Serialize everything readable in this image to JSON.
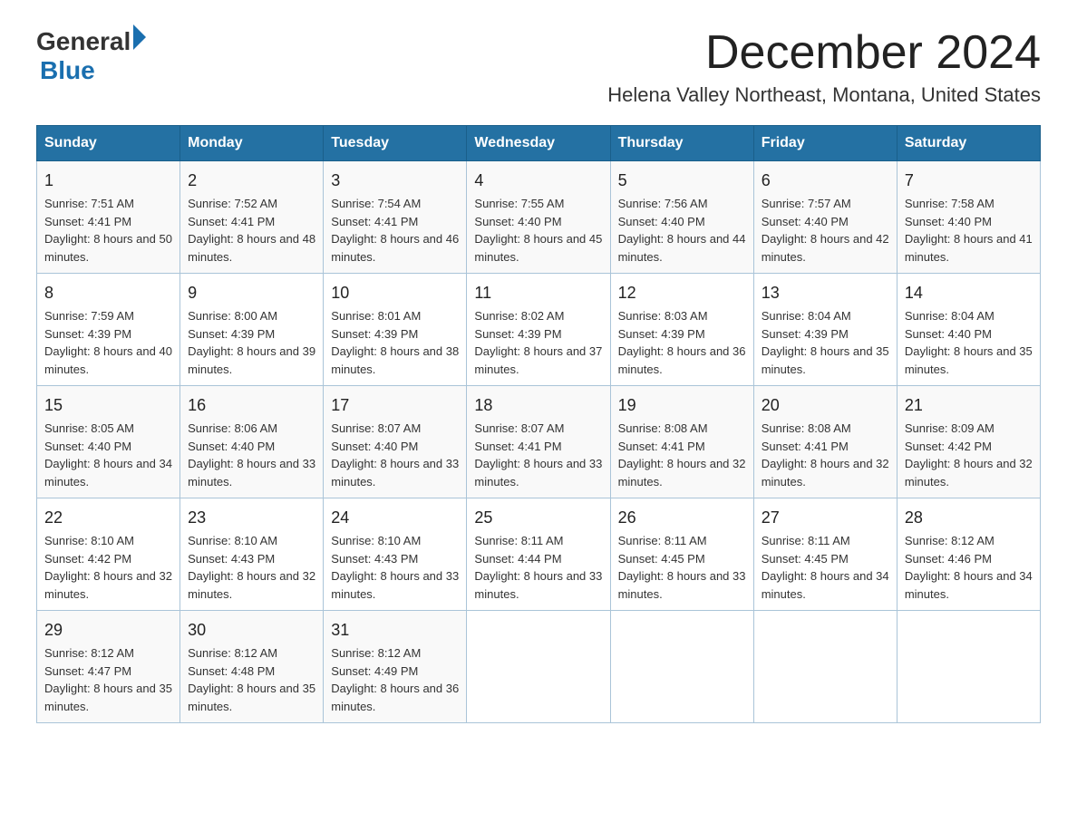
{
  "logo": {
    "text_general": "General",
    "text_blue": "Blue",
    "triangle_char": "▶"
  },
  "title": {
    "month_year": "December 2024",
    "location": "Helena Valley Northeast, Montana, United States"
  },
  "days_of_week": [
    "Sunday",
    "Monday",
    "Tuesday",
    "Wednesday",
    "Thursday",
    "Friday",
    "Saturday"
  ],
  "weeks": [
    [
      {
        "day": "1",
        "sunrise": "7:51 AM",
        "sunset": "4:41 PM",
        "daylight": "8 hours and 50 minutes."
      },
      {
        "day": "2",
        "sunrise": "7:52 AM",
        "sunset": "4:41 PM",
        "daylight": "8 hours and 48 minutes."
      },
      {
        "day": "3",
        "sunrise": "7:54 AM",
        "sunset": "4:41 PM",
        "daylight": "8 hours and 46 minutes."
      },
      {
        "day": "4",
        "sunrise": "7:55 AM",
        "sunset": "4:40 PM",
        "daylight": "8 hours and 45 minutes."
      },
      {
        "day": "5",
        "sunrise": "7:56 AM",
        "sunset": "4:40 PM",
        "daylight": "8 hours and 44 minutes."
      },
      {
        "day": "6",
        "sunrise": "7:57 AM",
        "sunset": "4:40 PM",
        "daylight": "8 hours and 42 minutes."
      },
      {
        "day": "7",
        "sunrise": "7:58 AM",
        "sunset": "4:40 PM",
        "daylight": "8 hours and 41 minutes."
      }
    ],
    [
      {
        "day": "8",
        "sunrise": "7:59 AM",
        "sunset": "4:39 PM",
        "daylight": "8 hours and 40 minutes."
      },
      {
        "day": "9",
        "sunrise": "8:00 AM",
        "sunset": "4:39 PM",
        "daylight": "8 hours and 39 minutes."
      },
      {
        "day": "10",
        "sunrise": "8:01 AM",
        "sunset": "4:39 PM",
        "daylight": "8 hours and 38 minutes."
      },
      {
        "day": "11",
        "sunrise": "8:02 AM",
        "sunset": "4:39 PM",
        "daylight": "8 hours and 37 minutes."
      },
      {
        "day": "12",
        "sunrise": "8:03 AM",
        "sunset": "4:39 PM",
        "daylight": "8 hours and 36 minutes."
      },
      {
        "day": "13",
        "sunrise": "8:04 AM",
        "sunset": "4:39 PM",
        "daylight": "8 hours and 35 minutes."
      },
      {
        "day": "14",
        "sunrise": "8:04 AM",
        "sunset": "4:40 PM",
        "daylight": "8 hours and 35 minutes."
      }
    ],
    [
      {
        "day": "15",
        "sunrise": "8:05 AM",
        "sunset": "4:40 PM",
        "daylight": "8 hours and 34 minutes."
      },
      {
        "day": "16",
        "sunrise": "8:06 AM",
        "sunset": "4:40 PM",
        "daylight": "8 hours and 33 minutes."
      },
      {
        "day": "17",
        "sunrise": "8:07 AM",
        "sunset": "4:40 PM",
        "daylight": "8 hours and 33 minutes."
      },
      {
        "day": "18",
        "sunrise": "8:07 AM",
        "sunset": "4:41 PM",
        "daylight": "8 hours and 33 minutes."
      },
      {
        "day": "19",
        "sunrise": "8:08 AM",
        "sunset": "4:41 PM",
        "daylight": "8 hours and 32 minutes."
      },
      {
        "day": "20",
        "sunrise": "8:08 AM",
        "sunset": "4:41 PM",
        "daylight": "8 hours and 32 minutes."
      },
      {
        "day": "21",
        "sunrise": "8:09 AM",
        "sunset": "4:42 PM",
        "daylight": "8 hours and 32 minutes."
      }
    ],
    [
      {
        "day": "22",
        "sunrise": "8:10 AM",
        "sunset": "4:42 PM",
        "daylight": "8 hours and 32 minutes."
      },
      {
        "day": "23",
        "sunrise": "8:10 AM",
        "sunset": "4:43 PM",
        "daylight": "8 hours and 32 minutes."
      },
      {
        "day": "24",
        "sunrise": "8:10 AM",
        "sunset": "4:43 PM",
        "daylight": "8 hours and 33 minutes."
      },
      {
        "day": "25",
        "sunrise": "8:11 AM",
        "sunset": "4:44 PM",
        "daylight": "8 hours and 33 minutes."
      },
      {
        "day": "26",
        "sunrise": "8:11 AM",
        "sunset": "4:45 PM",
        "daylight": "8 hours and 33 minutes."
      },
      {
        "day": "27",
        "sunrise": "8:11 AM",
        "sunset": "4:45 PM",
        "daylight": "8 hours and 34 minutes."
      },
      {
        "day": "28",
        "sunrise": "8:12 AM",
        "sunset": "4:46 PM",
        "daylight": "8 hours and 34 minutes."
      }
    ],
    [
      {
        "day": "29",
        "sunrise": "8:12 AM",
        "sunset": "4:47 PM",
        "daylight": "8 hours and 35 minutes."
      },
      {
        "day": "30",
        "sunrise": "8:12 AM",
        "sunset": "4:48 PM",
        "daylight": "8 hours and 35 minutes."
      },
      {
        "day": "31",
        "sunrise": "8:12 AM",
        "sunset": "4:49 PM",
        "daylight": "8 hours and 36 minutes."
      },
      null,
      null,
      null,
      null
    ]
  ],
  "labels": {
    "sunrise_prefix": "Sunrise: ",
    "sunset_prefix": "Sunset: ",
    "daylight_prefix": "Daylight: "
  }
}
